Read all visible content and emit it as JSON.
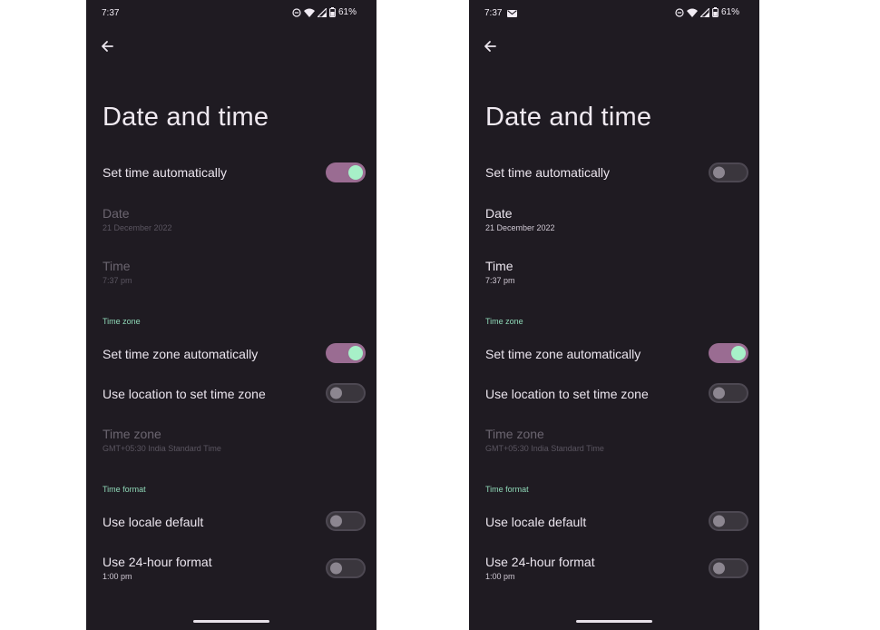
{
  "screens": [
    {
      "status": {
        "time": "7:37",
        "battery": "61%",
        "mail_icon": false
      },
      "title": "Date and time",
      "set_time_auto": {
        "label": "Set time automatically",
        "on": true
      },
      "date": {
        "label": "Date",
        "value": "21 December 2022",
        "enabled": false
      },
      "time": {
        "label": "Time",
        "value": "7:37 pm",
        "enabled": false
      },
      "tz_section": "Time zone",
      "set_tz_auto": {
        "label": "Set time zone automatically",
        "on": true
      },
      "use_location": {
        "label": "Use location to set time zone",
        "on": false
      },
      "time_zone": {
        "label": "Time zone",
        "value": "GMT+05:30 India Standard Time",
        "enabled": false
      },
      "format_section": "Time format",
      "locale_default": {
        "label": "Use locale default",
        "on": false
      },
      "use_24h": {
        "label": "Use 24-hour format",
        "value": "1:00 pm",
        "on": false
      }
    },
    {
      "status": {
        "time": "7:37",
        "battery": "61%",
        "mail_icon": true
      },
      "title": "Date and time",
      "set_time_auto": {
        "label": "Set time automatically",
        "on": false
      },
      "date": {
        "label": "Date",
        "value": "21 December 2022",
        "enabled": true
      },
      "time": {
        "label": "Time",
        "value": "7:37 pm",
        "enabled": true
      },
      "tz_section": "Time zone",
      "set_tz_auto": {
        "label": "Set time zone automatically",
        "on": true
      },
      "use_location": {
        "label": "Use location to set time zone",
        "on": false
      },
      "time_zone": {
        "label": "Time zone",
        "value": "GMT+05:30 India Standard Time",
        "enabled": false
      },
      "format_section": "Time format",
      "locale_default": {
        "label": "Use locale default",
        "on": false
      },
      "use_24h": {
        "label": "Use 24-hour format",
        "value": "1:00 pm",
        "on": false
      }
    }
  ],
  "colors": {
    "background": "#1f1b22",
    "accent": "#8fd9b8",
    "toggle_on_track": "#9a6c92",
    "toggle_on_knob": "#a7f0c8"
  },
  "icons": [
    "back-arrow-icon",
    "mail-icon",
    "dnd-icon",
    "wifi-icon",
    "signal-icon",
    "battery-icon"
  ]
}
